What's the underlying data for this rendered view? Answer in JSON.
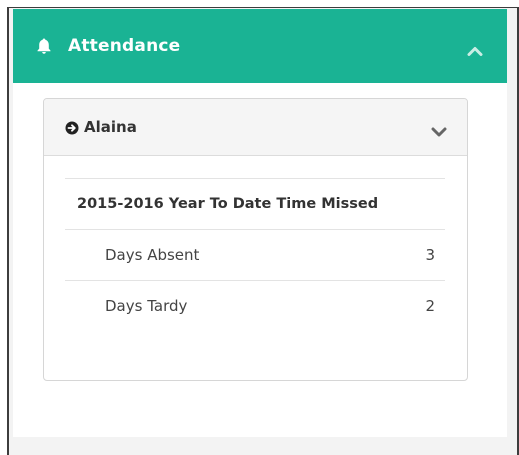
{
  "panel": {
    "title": "Attendance",
    "header_color": "#1ab394",
    "icons": {
      "header_icon": "bell-icon",
      "collapse_icon": "chevron-up-icon"
    }
  },
  "student": {
    "name": "Alaina",
    "icons": {
      "name_icon": "arrow-circle-right-icon",
      "toggle_icon": "chevron-down-icon"
    },
    "attendance": {
      "heading": "2015-2016 Year To Date Time Missed",
      "rows": [
        {
          "label": "Days Absent",
          "value": "3"
        },
        {
          "label": "Days Tardy",
          "value": "2"
        }
      ]
    }
  }
}
